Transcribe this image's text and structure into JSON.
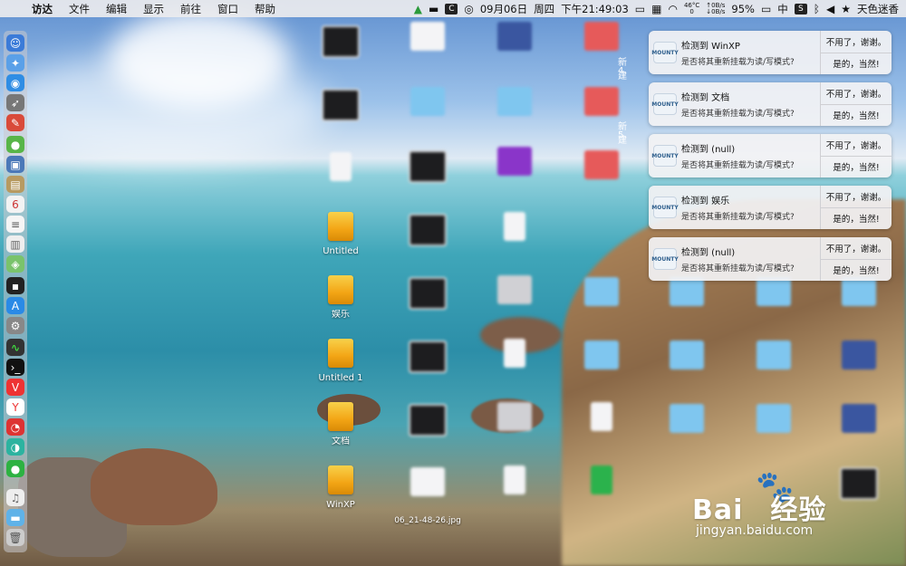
{
  "menubar": {
    "items": [
      "访达",
      "文件",
      "编辑",
      "显示",
      "前往",
      "窗口",
      "帮助"
    ],
    "date": "09月06日",
    "weekday": "周四",
    "time": "下午21:49:03",
    "temp": "46°C",
    "temp_sub": "0",
    "net_up": "↑0B/s",
    "net_down": "↓0B/s",
    "battery": "95%",
    "input_method": "中",
    "s_icon": "S",
    "user": "天色迷香",
    "c_icon": "C"
  },
  "desktop": {
    "drives": [
      {
        "label": "Untitled"
      },
      {
        "label": "娱乐"
      },
      {
        "label": "Untitled 1"
      },
      {
        "label": "文档"
      },
      {
        "label": "WinXP"
      }
    ],
    "partial_labels": [
      "新建",
      "4",
      "新建",
      "5"
    ],
    "screenshot_label": "06_21-48-26.jpg"
  },
  "notifications": [
    {
      "title": "检测到 WinXP",
      "subtitle": "是否将其重新挂载为读/写模式?",
      "decline": "不用了，谢谢。",
      "accept": "是的，当然!"
    },
    {
      "title": "检测到 文档",
      "subtitle": "是否将其重新挂载为读/写模式?",
      "decline": "不用了，谢谢。",
      "accept": "是的，当然!"
    },
    {
      "title": "检测到 (null)",
      "subtitle": "是否将其重新挂载为读/写模式?",
      "decline": "不用了，谢谢。",
      "accept": "是的，当然!"
    },
    {
      "title": "检测到 娱乐",
      "subtitle": "是否将其重新挂载为读/写模式?",
      "decline": "不用了，谢谢。",
      "accept": "是的，当然!"
    },
    {
      "title": "检测到 (null)",
      "subtitle": "是否将其重新挂载为读/写模式?",
      "decline": "不用了，谢谢。",
      "accept": "是的，当然!"
    }
  ],
  "notif_logo_text": "MOUNTY",
  "watermark": {
    "brand": "Bai",
    "brand2": "经验",
    "url": "jingyan.baidu.com"
  }
}
